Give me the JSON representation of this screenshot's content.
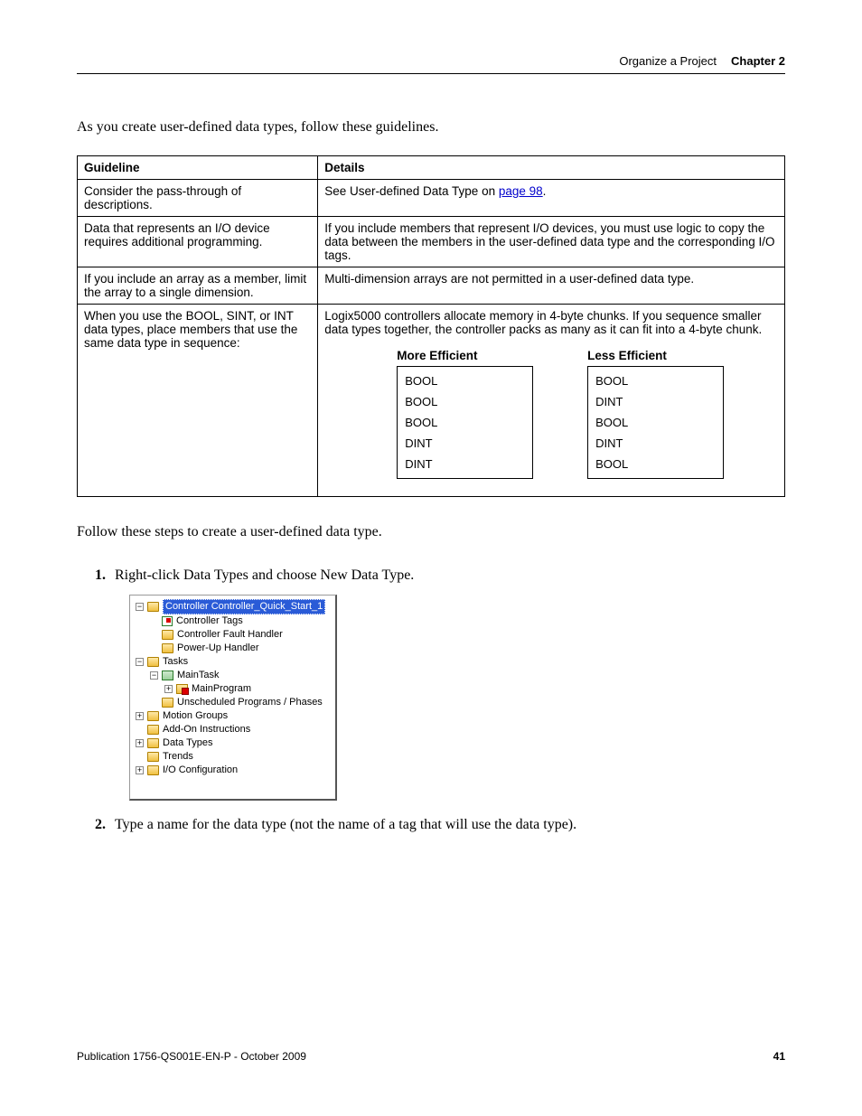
{
  "header": {
    "chapter_title": "Organize a Project",
    "chapter_label": "Chapter 2"
  },
  "intro": "As you create user-defined data types, follow these guidelines.",
  "table": {
    "headers": {
      "col1": "Guideline",
      "col2": "Details"
    },
    "rows": [
      {
        "guideline": "Consider the pass-through of descriptions.",
        "details_pre": "See User-defined Data Type on ",
        "details_link": "page 98",
        "details_post": "."
      },
      {
        "guideline": "Data that represents an I/O device requires additional programming.",
        "details": "If you include members that represent I/O devices, you must use logic to copy the data between the members in the user-defined data type and the corresponding I/O tags."
      },
      {
        "guideline": "If you include an array as a member, limit the array to a single dimension.",
        "details": "Multi-dimension arrays are not permitted in a user-defined data type."
      },
      {
        "guideline": "When you use the BOOL, SINT, or INT data types, place members that use the same data type in sequence:",
        "details": "Logix5000 controllers allocate memory in 4-byte chunks. If you sequence smaller data types together, the controller packs as many as it can fit into a 4-byte chunk."
      }
    ]
  },
  "efficiency": {
    "more": {
      "title": "More Efficient",
      "items": [
        "BOOL",
        "BOOL",
        "BOOL",
        "DINT",
        "DINT"
      ]
    },
    "less": {
      "title": "Less Efficient",
      "items": [
        "BOOL",
        "DINT",
        "BOOL",
        "DINT",
        "BOOL"
      ]
    }
  },
  "follow": "Follow these steps to create a user-defined data type.",
  "steps": {
    "s1": {
      "num": "1.",
      "text": "Right-click Data Types and choose New Data Type."
    },
    "s2": {
      "num": "2.",
      "text": "Type a name for the data type (not the name of a tag that will use the data type)."
    }
  },
  "tree": {
    "controller": "Controller Controller_Quick_Start_1",
    "controller_tags": "Controller Tags",
    "fault_handler": "Controller Fault Handler",
    "powerup": "Power-Up Handler",
    "tasks": "Tasks",
    "maintask": "MainTask",
    "mainprogram": "MainProgram",
    "unscheduled": "Unscheduled Programs / Phases",
    "motion": "Motion Groups",
    "addon": "Add-On Instructions",
    "datatypes": "Data Types",
    "trends": "Trends",
    "ioconfig": "I/O Configuration"
  },
  "footer": {
    "pub": "Publication 1756-QS001E-EN-P - October 2009",
    "page": "41"
  }
}
